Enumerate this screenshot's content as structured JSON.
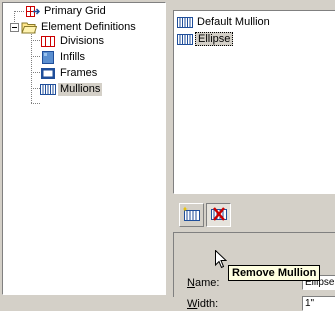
{
  "tree": {
    "items": [
      {
        "label": "Primary Grid",
        "icon": "primary-grid-icon"
      },
      {
        "label": "Element Definitions",
        "icon": "folder-open-icon",
        "expanded": true
      },
      {
        "label": "Divisions",
        "icon": "divisions-icon"
      },
      {
        "label": "Infills",
        "icon": "infills-icon"
      },
      {
        "label": "Frames",
        "icon": "frames-icon"
      },
      {
        "label": "Mullions",
        "icon": "mullions-icon",
        "selected": true
      }
    ]
  },
  "list": {
    "items": [
      {
        "label": "Default Mullion",
        "icon": "mullion-icon"
      },
      {
        "label": "Ellipse",
        "icon": "mullion-icon",
        "selected": true
      }
    ]
  },
  "toolbar": {
    "buttons": [
      {
        "icon": "new-mullion-icon"
      },
      {
        "icon": "remove-mullion-icon"
      }
    ]
  },
  "tooltip": {
    "text": "Remove Mullion"
  },
  "properties": {
    "name": {
      "label": "Name:",
      "value": "Ellipse"
    },
    "width": {
      "label": "Width:",
      "value": "1\""
    }
  },
  "colors": {
    "face": "#d4d0c8",
    "tooltip_bg": "#ffffe1",
    "accent": "#3a6ea5",
    "primary_red": "#cc0000"
  }
}
